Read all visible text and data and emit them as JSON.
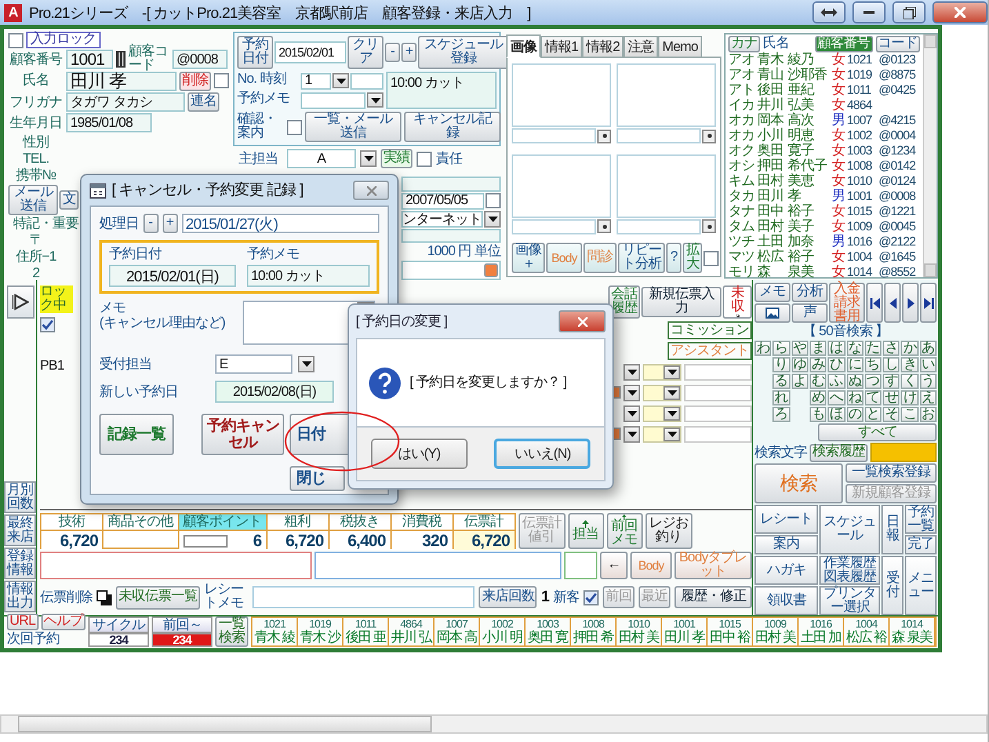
{
  "window": {
    "app_letter": "A",
    "title": "Pro.21シリーズ　-[ カットPro.21美容室　京都駅前店　顧客登録・来店入力　]"
  },
  "customer": {
    "lock_label": "入力ロック",
    "lock_checked": false,
    "number_label": "顧客番号",
    "number": "1001",
    "code_label": "顧客コード",
    "code": "@0008",
    "name_label": "氏名",
    "name": "田川 孝",
    "delete_button": "削除",
    "delete_checked": false,
    "kana_label": "フリガナ",
    "kana": "タガワ タカシ",
    "joint_button": "連名",
    "birth_label": "生年月日",
    "birth": "1985/01/08",
    "more_labels": [
      "性別",
      "TEL.",
      "携帯№"
    ],
    "mail_button": "メール送信",
    "text_button": "文",
    "notes_label": "特記・重要",
    "postal_label": "〒",
    "address1_label": "住所−1",
    "address2_label": "2",
    "since": "2007/05/05",
    "since_checked": false,
    "source": "ンターネット",
    "unit": "1000 円 単位"
  },
  "reservation": {
    "date_button": "予約日付",
    "date": "2015/02/01",
    "clear_button": "クリア",
    "minus_button": "-",
    "plus_button": "+",
    "schedule_button": "スケジュール登録",
    "no_label": "No. 時刻",
    "memo_label": "予約メモ",
    "no": "1",
    "memo": "10:00 カット",
    "confirm_label": "確認・案内",
    "confirm_checked": false,
    "mail_button": "一覧・メール送信",
    "cancel_button": "キャンセル記録",
    "staff_label": "主担当",
    "staff": "A",
    "actual_button": "実績",
    "responsible_checked": false,
    "responsible_label": "責任"
  },
  "tabs": [
    {
      "label": "画像",
      "selected": true
    },
    {
      "label": "情報1",
      "selected": false
    },
    {
      "label": "情報2",
      "selected": false
    },
    {
      "label": "注意",
      "selected": false
    },
    {
      "label": "Memo",
      "selected": false
    }
  ],
  "image_panel": {
    "buttons": [
      {
        "label": "画像＋",
        "kind": "blue"
      },
      {
        "label": "Body",
        "kind": "orange"
      },
      {
        "label": "問診",
        "kind": "orange"
      },
      {
        "label": "リピート分析",
        "kind": "blue"
      },
      {
        "label": "?",
        "kind": "blue"
      },
      {
        "label": "拡大",
        "kind": "green"
      }
    ],
    "enlarge_checked": false
  },
  "customer_list": {
    "kana_header": "カナ",
    "name_header": "氏名",
    "number_header": "顧客番号",
    "code_header": "コード",
    "rows": [
      {
        "kana": "アオ",
        "surname": "青木",
        "given": "綾乃",
        "sex": "女",
        "color": "#d42020",
        "number": "1021",
        "code": "@0123"
      },
      {
        "kana": "アオ",
        "surname": "青山",
        "given": "沙耶香",
        "sex": "女",
        "color": "#d42020",
        "number": "1019",
        "code": "@8875"
      },
      {
        "kana": "アト",
        "surname": "後田",
        "given": "亜紀",
        "sex": "女",
        "color": "#d42020",
        "number": "1011",
        "code": "@0425"
      },
      {
        "kana": "イカ",
        "surname": "井川",
        "given": "弘美",
        "sex": "女",
        "color": "#d42020",
        "number": "4864"
      },
      {
        "kana": "オカ",
        "surname": "岡本",
        "given": "高次",
        "sex": "男",
        "color": "#2030c0",
        "number": "1007",
        "code": "@4215"
      },
      {
        "kana": "オカ",
        "surname": "小川",
        "given": "明恵",
        "sex": "女",
        "color": "#d42020",
        "number": "1002",
        "code": "@0004"
      },
      {
        "kana": "オク",
        "surname": "奥田",
        "given": "寛子",
        "sex": "女",
        "color": "#d42020",
        "number": "1003",
        "code": "@1234"
      },
      {
        "kana": "オシ",
        "surname": "押田",
        "given": "希代子",
        "sex": "女",
        "color": "#d42020",
        "number": "1008",
        "code": "@0142"
      },
      {
        "kana": "キム",
        "surname": "田村",
        "given": "美恵",
        "sex": "女",
        "color": "#d42020",
        "number": "1010",
        "code": "@0124"
      },
      {
        "kana": "タカ",
        "surname": "田川",
        "given": "孝",
        "sex": "男",
        "color": "#2030c0",
        "number": "1001",
        "code": "@0008"
      },
      {
        "kana": "タナ",
        "surname": "田中",
        "given": "裕子",
        "sex": "女",
        "color": "#d42020",
        "number": "1015",
        "code": "@1221"
      },
      {
        "kana": "タム",
        "surname": "田村",
        "given": "美子",
        "sex": "女",
        "color": "#d42020",
        "number": "1009",
        "code": "@0045"
      },
      {
        "kana": "ツチ",
        "surname": "土田",
        "given": "加奈",
        "sex": "男",
        "color": "#2030c0",
        "number": "1016",
        "code": "@2122"
      },
      {
        "kana": "マツ",
        "surname": "松広",
        "given": "裕子",
        "sex": "女",
        "color": "#d42020",
        "number": "1004",
        "code": "@1645"
      },
      {
        "kana": "モリ",
        "surname": "森",
        "given": "泉美",
        "sex": "女",
        "color": "#d42020",
        "number": "1014",
        "code": "@8552"
      }
    ]
  },
  "slip": {
    "lock_label": "ロック中",
    "lock_checked": true,
    "row_code": "PB1",
    "history_button": "会話履歴",
    "new_slip_button": "新規伝票入力",
    "unpaid_label": "未収",
    "commission_header": "コミッション",
    "assistant_header": "アシスタント"
  },
  "side_tabs": [
    "月別回数",
    "最終来店",
    "登録情報",
    "情報出力"
  ],
  "totals": [
    {
      "label": "技術",
      "value": "6,720",
      "kind": "plain"
    },
    {
      "label": "商品その他",
      "kind": "plain"
    },
    {
      "label": "顧客ポイント",
      "value": "6",
      "kind": "points"
    },
    {
      "label": "粗利",
      "value": "6,720",
      "kind": "plain"
    },
    {
      "label": "税抜き",
      "value": "6,400",
      "kind": "plain"
    },
    {
      "label": "消費税",
      "value": "320",
      "kind": "plain"
    },
    {
      "label": "伝票計",
      "value": "6,720",
      "kind": "total"
    }
  ],
  "total_buttons": [
    {
      "label": "伝票計値引",
      "kind": "disabled"
    },
    {
      "label": "担当",
      "kind": "up"
    },
    {
      "label": "前回メモ",
      "kind": "up"
    },
    {
      "label": "レジお釣り",
      "kind": "plain"
    }
  ],
  "info_buttons": [
    {
      "label": "←",
      "kind": "plain"
    },
    {
      "label": "Body",
      "kind": "orange"
    },
    {
      "label": "Bodyタブレット",
      "kind": "orange"
    }
  ],
  "slip_footer": {
    "delete_label": "伝票削除",
    "unpaid_list_button": "未収伝票一覧",
    "receipt_memo_label": "レシートメモ",
    "visits_button": "来店回数",
    "visits": "1",
    "new_label": "新客",
    "new_checked": true,
    "previous_button": "前回",
    "recent_button": "最近",
    "history_button": "履歴・修正"
  },
  "search_panel": {
    "memo_button": "メモ",
    "analysis_button": "分析",
    "voice_button": "声",
    "billing_button": "入金請求書用",
    "title": "【 50音検索 】",
    "kana_columns": [
      [
        "わ"
      ],
      [
        "ら",
        "り",
        "る",
        "れ",
        "ろ"
      ],
      [
        "や",
        "ゆ",
        "よ"
      ],
      [
        "ま",
        "み",
        "む",
        "め",
        "も"
      ],
      [
        "は",
        "ひ",
        "ふ",
        "へ",
        "ほ"
      ],
      [
        "な",
        "に",
        "ぬ",
        "ね",
        "の"
      ],
      [
        "た",
        "ち",
        "つ",
        "て",
        "と"
      ],
      [
        "さ",
        "し",
        "す",
        "せ",
        "そ"
      ],
      [
        "か",
        "き",
        "く",
        "け",
        "こ"
      ],
      [
        "あ",
        "い",
        "う",
        "え",
        "お"
      ]
    ],
    "all_button": "すべて",
    "search_text_label": "検索文字",
    "history_tab": "検索履歴",
    "search_button": "検索",
    "list_register_button": "一覧検索登録",
    "new_customer_button": "新規顧客登録",
    "menu": {
      "receipt": "レシート",
      "guide": "案内",
      "schedule": "スケジュール",
      "daily": "日報",
      "reservations": "予約一覧",
      "done": "完了",
      "postcard": "ハガキ",
      "work_history": "作業履歴図表履歴",
      "reception": "受付",
      "menu": "メニュー",
      "invoice": "領収書",
      "printer": "プリンター選択"
    }
  },
  "next_bar": {
    "label": "次回予約",
    "url_button": "URL",
    "help_button": "ヘルプ",
    "cycle_label": "サイクル",
    "cycle": "234",
    "since_label": "前回～",
    "since": "234",
    "search_button": "一覧検索",
    "customers": [
      {
        "number": "1021",
        "name": "青木 綾"
      },
      {
        "number": "1019",
        "name": "青木 沙"
      },
      {
        "number": "1011",
        "name": "後田 亜"
      },
      {
        "number": "4864",
        "name": "井川 弘"
      },
      {
        "number": "1007",
        "name": "岡本 高"
      },
      {
        "number": "1002",
        "name": "小川 明"
      },
      {
        "number": "1003",
        "name": "奥田 寛"
      },
      {
        "number": "1008",
        "name": "押田 希"
      },
      {
        "number": "1010",
        "name": "田村 美"
      },
      {
        "number": "1001",
        "name": "田川 孝"
      },
      {
        "number": "1015",
        "name": "田中 裕"
      },
      {
        "number": "1009",
        "name": "田村 美"
      },
      {
        "number": "1016",
        "name": "土田 加"
      },
      {
        "number": "1004",
        "name": "松広 裕"
      },
      {
        "number": "1014",
        "name": "森 泉美"
      }
    ]
  },
  "cancel_dialog": {
    "title": "[ キャンセル・予約変更 記録 ]",
    "process_label": "処理日",
    "minus_button": "-",
    "plus_button": "+",
    "process_date": "2015/01/27(火)",
    "date_label": "予約日付",
    "date": "2015/02/01(日)",
    "memo_label": "予約メモ",
    "memo": "10:00 カット",
    "note_label": "メモ",
    "note_hint": "(キャンセル理由など)",
    "staff_label": "受付担当",
    "staff": "E",
    "new_date_label": "新しい予約日",
    "new_date": "2015/02/08(日)",
    "buttons": [
      {
        "label": "記録一覧",
        "kind": "list"
      },
      {
        "label": "予約キャンセル",
        "kind": "cancel"
      },
      {
        "label": "日付",
        "kind": "change"
      },
      {
        "label": "閉じ",
        "kind": "close"
      }
    ]
  },
  "confirm_dialog": {
    "title": "[ 予約日の変更 ]",
    "message": "[ 予約日を変更しますか？ ]",
    "buttons": [
      {
        "label": "はい(Y)",
        "selected": false
      },
      {
        "label": "いいえ(N)",
        "selected": true
      }
    ]
  }
}
